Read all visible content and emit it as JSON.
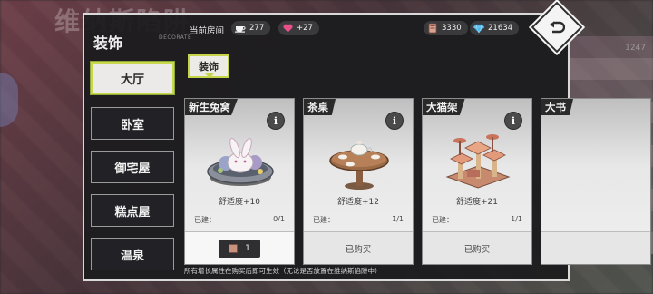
{
  "background": {
    "title_text": "维纳斯陷阱",
    "side_numbers": [
      "1247"
    ]
  },
  "dialog": {
    "title": "装饰",
    "subtitle": "DECORATE"
  },
  "topbar": {
    "room_label": "当前房间",
    "room_value": "277",
    "heart_value": "+27",
    "ticket_value": "3330",
    "gem_value": "21634"
  },
  "categories": [
    {
      "label": "大厅",
      "active": true
    },
    {
      "label": "卧室",
      "active": false
    },
    {
      "label": "御宅屋",
      "active": false
    },
    {
      "label": "糕点屋",
      "active": false
    },
    {
      "label": "温泉",
      "active": false
    }
  ],
  "subtab": {
    "label": "装饰"
  },
  "cards": [
    {
      "name": "新生兔窝",
      "comfort": "舒适度+10",
      "built_label": "已建：",
      "built_value": "0/1",
      "footer_type": "buy",
      "price": "1"
    },
    {
      "name": "茶桌",
      "comfort": "舒适度+12",
      "built_label": "已建：",
      "built_value": "1/1",
      "footer_type": "owned",
      "footer_text": "已购买"
    },
    {
      "name": "大猫架",
      "comfort": "舒适度+21",
      "built_label": "已建：",
      "built_value": "1/1",
      "footer_type": "owned",
      "footer_text": "已购买"
    },
    {
      "name": "大书",
      "comfort": "",
      "built_label": "",
      "built_value": "",
      "footer_type": "owned",
      "footer_text": ""
    }
  ],
  "info_label": "i",
  "footnote": "所有增长属性在购买后即可生效（无论是否放置在维纳斯陷阱中）",
  "colors": {
    "accent_green": "#c9d84a",
    "dialog_bg": "#1c1c1e",
    "heart": "#e8508a",
    "gem": "#4fb6e8"
  }
}
